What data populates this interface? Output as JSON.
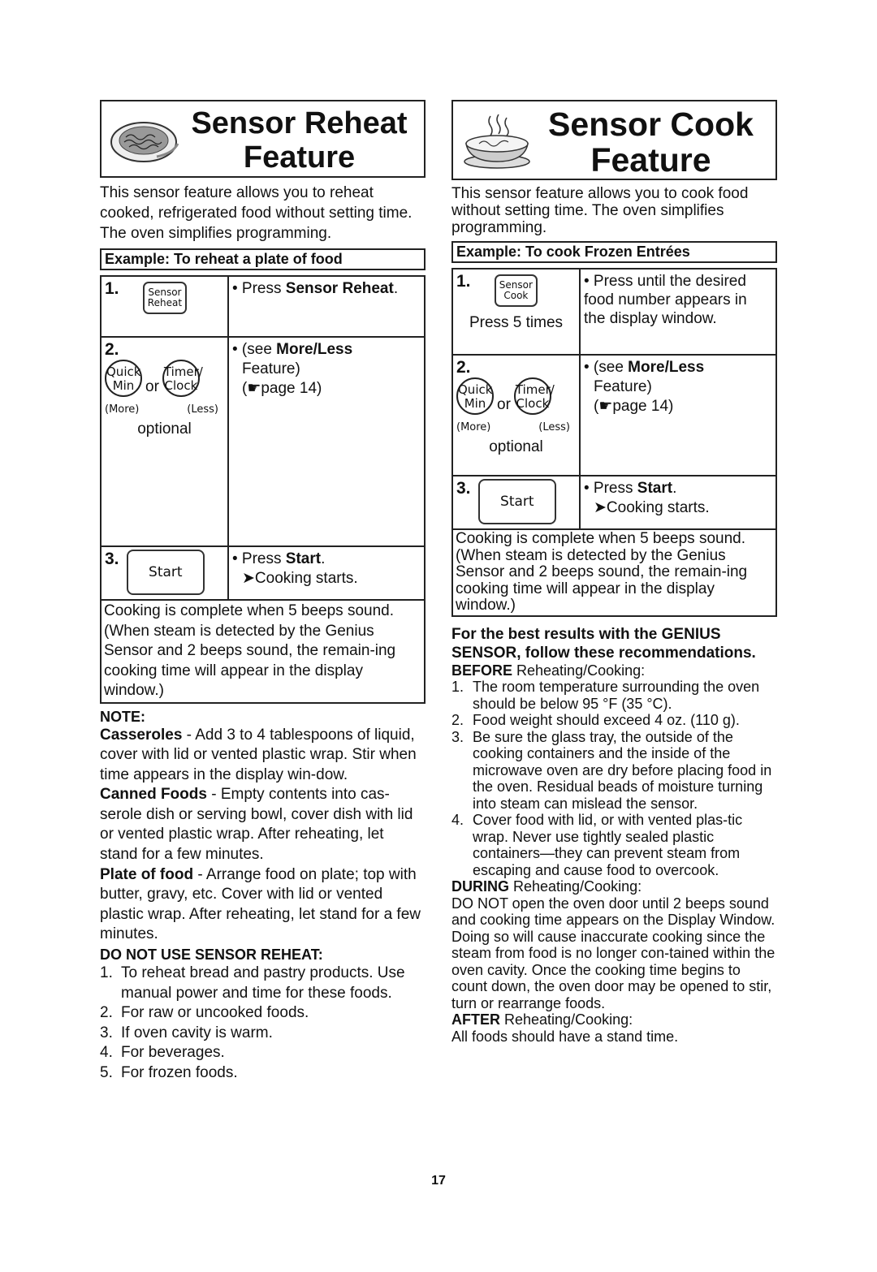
{
  "page_number": "17",
  "reheat": {
    "title_line1": "Sensor Reheat",
    "title_line2": "Feature",
    "intro": "This sensor feature allows you to reheat cooked, refrigerated food without setting time. The oven simplifies programming.",
    "example": "Example: To reheat a plate of food",
    "step1": {
      "num": "1.",
      "key_line1": "Sensor",
      "key_line2": "Reheat",
      "text_pre": "• Press ",
      "text_bold": "Sensor Reheat",
      "text_post": "."
    },
    "step2": {
      "num": "2.",
      "quick_line1": "Quick",
      "quick_line2": "Min",
      "or": "or",
      "timer_line1": "Timer/",
      "timer_line2": "Clock",
      "more": "(More)",
      "less": "(Less)",
      "optional": "optional",
      "text_pre": "• (see ",
      "text_bold": "More/Less",
      "text_line2": "Feature)",
      "text_line3": "(☛page 14)"
    },
    "step3": {
      "num": "3.",
      "key": "Start",
      "text_pre": "• Press ",
      "text_bold": "Start",
      "text_post": ".",
      "text_line2": "➤Cooking starts."
    },
    "complete": "Cooking is complete when 5 beeps sound. (When steam is detected by the Genius Sensor and 2 beeps sound, the remain-ing cooking time will appear in the display window.)",
    "note_heading": "NOTE:",
    "notes": [
      {
        "bold": "Casseroles",
        "text": " - Add 3 to 4 tablespoons of liquid, cover with lid or vented plastic wrap. Stir when time appears in the display win-dow."
      },
      {
        "bold": "Canned Foods",
        "text": " - Empty contents into cas-serole dish or serving bowl, cover dish with lid or vented plastic wrap. After reheating, let stand for a few minutes."
      },
      {
        "bold": "Plate of food",
        "text": " - Arrange food on plate; top with butter, gravy, etc. Cover with lid or vented plastic wrap. After reheating, let stand for a few minutes."
      }
    ],
    "donot_heading": "DO NOT USE SENSOR REHEAT:",
    "donot_items": [
      {
        "n": "1.",
        "text": "To reheat bread and pastry products. Use manual power and time for these foods."
      },
      {
        "n": "2.",
        "text": "For raw or uncooked foods."
      },
      {
        "n": "3.",
        "text": "If oven cavity is warm."
      },
      {
        "n": "4.",
        "text": "For beverages."
      },
      {
        "n": "5.",
        "text": "For frozen foods."
      }
    ]
  },
  "cook": {
    "title_line1": "Sensor Cook",
    "title_line2": "Feature",
    "intro": "This sensor feature allows you to cook food without setting time. The oven simplifies programming.",
    "example": "Example: To cook Frozen Entrées",
    "step1": {
      "num": "1.",
      "key_line1": "Sensor",
      "key_line2": "Cook",
      "press_times": "Press 5 times",
      "text": "• Press until the desired food number appears in the display window."
    },
    "step2": {
      "num": "2.",
      "quick_line1": "Quick",
      "quick_line2": "Min",
      "or": "or",
      "timer_line1": "Timer/",
      "timer_line2": "Clock",
      "more": "(More)",
      "less": "(Less)",
      "optional": "optional",
      "text_pre": "• (see ",
      "text_bold": "More/Less",
      "text_line2": "Feature)",
      "text_line3": "(☛page 14)"
    },
    "step3": {
      "num": "3.",
      "key": "Start",
      "text_pre": "• Press ",
      "text_bold": "Start",
      "text_post": ".",
      "text_line2": "➤Cooking starts."
    },
    "complete": "Cooking is complete when 5 beeps sound. (When steam is detected by the Genius Sensor and 2 beeps sound, the remain-ing cooking time will appear in the display window.)"
  },
  "recommendations": {
    "heading": "For the best results with the GENIUS SENSOR, follow these recommendations.",
    "before_bold": "BEFORE",
    "before_text": " Reheating/Cooking:",
    "before_items": [
      {
        "n": "1.",
        "text": "The room temperature surrounding the oven should be below 95 °F (35 °C)."
      },
      {
        "n": "2.",
        "text": "Food weight should exceed 4 oz. (110 g)."
      },
      {
        "n": "3.",
        "text": "Be sure the glass tray, the outside of the cooking containers and the inside of the microwave oven are dry before placing food in the oven. Residual beads of moisture turning into steam can mislead the sensor."
      },
      {
        "n": "4.",
        "text": "Cover food with lid, or with vented plas-tic wrap. Never use tightly sealed plastic containers—they can prevent steam from escaping and cause food to overcook."
      }
    ],
    "during_bold": "DURING",
    "during_text": " Reheating/Cooking:",
    "during_body": "DO NOT open the oven door until 2 beeps sound and cooking time appears on the Display Window. Doing so will cause inaccurate cooking since the steam from food is no longer con-tained within the oven cavity. Once the cooking time begins to count down, the oven door may be opened to stir, turn or rearrange foods.",
    "after_bold": "AFTER",
    "after_text": " Reheating/Cooking:",
    "after_body": "All foods should have a stand time."
  }
}
